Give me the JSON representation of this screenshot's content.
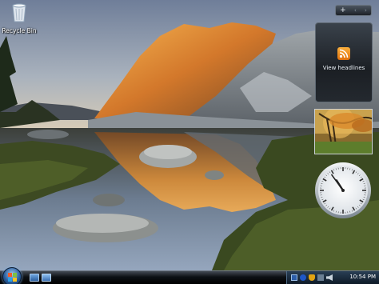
{
  "desktop": {
    "icons": [
      {
        "label": "Recycle Bin",
        "icon": "recycle-bin-icon"
      }
    ]
  },
  "sidebar": {
    "controls": {
      "add": "+",
      "prev": "‹",
      "next": "›"
    },
    "feed_gadget": {
      "label": "View headlines",
      "icon": "rss-icon"
    },
    "clock": {
      "hour": 10,
      "minute": 54
    }
  },
  "taskbar": {
    "start": "start-orb-icon",
    "quick_launch": [
      "show-desktop-icon",
      "switch-windows-icon"
    ],
    "tray_icons": [
      "language-icon",
      "bluetooth-icon",
      "security-shield-icon",
      "network-icon",
      "volume-icon"
    ],
    "time": "10:54 PM"
  },
  "colors": {
    "sky_top": "#8d9ab0",
    "peak_glow": "#f2a53f",
    "lake": "#2e3644",
    "grass": "#4a5a24",
    "taskbar": "#0d1014",
    "rss": "#f29b24"
  }
}
